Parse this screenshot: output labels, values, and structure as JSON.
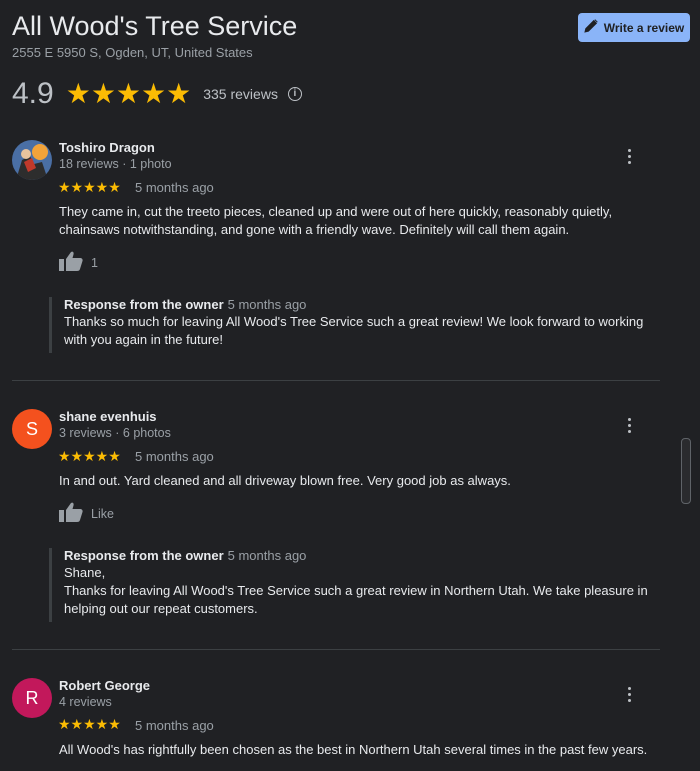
{
  "business": {
    "name": "All Wood's Tree Service",
    "address": "2555 E 5950 S, Ogden, UT, United States",
    "rating": "4.9",
    "stars": "★★★★★",
    "review_count": "335 reviews",
    "write_review_label": "Write a review"
  },
  "reviews": [
    {
      "name": "Toshiro Dragon",
      "meta": "18 reviews · 1 photo",
      "stars": "★★★★★",
      "date": "5 months ago",
      "text": "They came in, cut the treeto pieces, cleaned up and were out of here quickly, reasonably quietly, chainsaws notwithstanding, and gone with a friendly wave. Definitely will call them again.",
      "likes": "1",
      "response": {
        "label": "Response from the owner",
        "date": "5 months ago",
        "text": "Thanks so much for leaving All Wood's Tree Service such a great review! We look forward to working with you again in the future!"
      }
    },
    {
      "name": "shane evenhuis",
      "avatar_letter": "S",
      "meta": "3 reviews · 6 photos",
      "stars": "★★★★★",
      "date": "5 months ago",
      "text": "In and out. Yard cleaned and all driveway blown free. Very good job as always.",
      "likes": "Like",
      "response": {
        "label": "Response from the owner",
        "date": "5 months ago",
        "greeting": "Shane,",
        "text": "Thanks for leaving All Wood's Tree Service such a great review in Northern Utah. We take pleasure in helping out our repeat customers."
      }
    },
    {
      "name": "Robert George",
      "avatar_letter": "R",
      "meta": "4 reviews",
      "stars": "★★★★★",
      "date": "5 months ago",
      "text": "All Wood's has rightfully been chosen as the best in Northern Utah several times in the past few years."
    }
  ],
  "colors": {
    "background": "#202124",
    "star": "#fbbc04",
    "button": "#8ab4f8",
    "avatar_s": "#f4511e",
    "avatar_r": "#c2185b"
  }
}
